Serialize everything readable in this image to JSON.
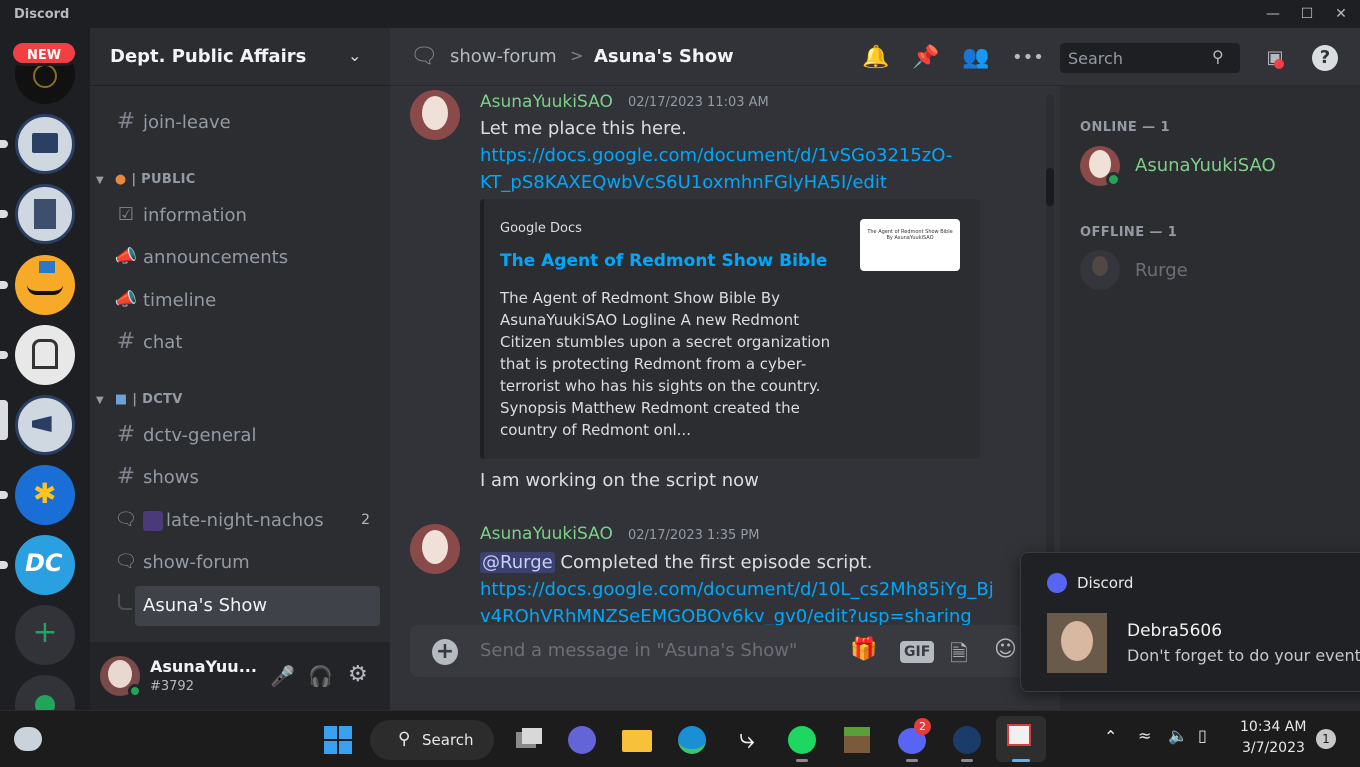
{
  "window": {
    "app_name": "Discord"
  },
  "rail": {
    "new_badge": "NEW"
  },
  "guild": {
    "name": "Dept. Public Affairs"
  },
  "channels": {
    "join_leave": "join-leave",
    "cat_public": "| PUBLIC",
    "information": "information",
    "announcements": "announcements",
    "timeline": "timeline",
    "chat": "chat",
    "cat_dctv": "| DCTV",
    "dctv_general": "dctv-general",
    "shows": "shows",
    "late_night": "late-night-nachos",
    "late_night_count": "2",
    "show_forum": "show-forum",
    "active_thread": "Asuna's Show"
  },
  "user_panel": {
    "name": "AsunaYuu...",
    "tag": "#3792"
  },
  "topbar": {
    "forum": "show-forum",
    "sep": ">",
    "thread": "Asuna's Show",
    "search_placeholder": "Search"
  },
  "messages": [
    {
      "author": "AsunaYuukiSAO",
      "time": "02/17/2023 11:03 AM",
      "text": "Let me place this here.",
      "link_line1": "https://docs.google.com/document/d/1vSGo3215zO-",
      "link_line2": "KT_pS8KAXEQwbVcS6U1oxmhnFGlyHA5I/edit",
      "embed": {
        "provider": "Google Docs",
        "title": "The Agent of Redmont Show Bible",
        "desc": [
          "The Agent of Redmont Show Bible By",
          "AsunaYuukiSAO Logline A new Redmont",
          "Citizen stumbles upon a secret organization",
          "that is protecting Redmont from a cyber-",
          "terrorist who has his sights on the country.",
          "Synopsis Matthew Redmont created the",
          "country of Redmont onl..."
        ],
        "thumb_line1": "The Agent of Redmont Show Bible",
        "thumb_line2": "By AsunaYuukiSAO"
      },
      "followup": "I am working on the script now"
    },
    {
      "author": "AsunaYuukiSAO",
      "time": "02/17/2023 1:35 PM",
      "mention": "@Rurge",
      "text": " Completed the first episode script.",
      "link_line1": "https://docs.google.com/document/d/10L_cs2Mh85iYg_Bj",
      "link_line2": "v4ROhVRhMNZSeEMGOBOv6kv_gv0/edit?usp=sharing"
    }
  ],
  "composer": {
    "placeholder": "Send a message in \"Asuna's Show\"",
    "gif": "GIF"
  },
  "members": {
    "online_header": "ONLINE — 1",
    "online": [
      "AsunaYuukiSAO"
    ],
    "offline_header": "OFFLINE — 1",
    "offline": [
      "Rurge"
    ]
  },
  "toast": {
    "app": "Discord",
    "title": "Debra5606",
    "body": "Don't forget to do your events"
  },
  "taskbar": {
    "search": "Search",
    "time": "10:34 AM",
    "date": "3/7/2023",
    "discord_badge": "2",
    "notif_count": "1"
  },
  "colors": {
    "accent": "#5865f2",
    "username": "#7fcf8a",
    "link": "#00a8fc",
    "online": "#23a559"
  }
}
